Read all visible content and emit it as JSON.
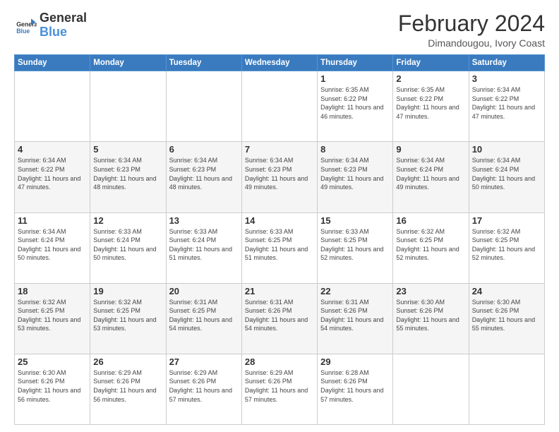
{
  "logo": {
    "line1": "General",
    "line2": "Blue"
  },
  "title": "February 2024",
  "subtitle": "Dimandougou, Ivory Coast",
  "days_of_week": [
    "Sunday",
    "Monday",
    "Tuesday",
    "Wednesday",
    "Thursday",
    "Friday",
    "Saturday"
  ],
  "weeks": [
    [
      {
        "day": "",
        "info": ""
      },
      {
        "day": "",
        "info": ""
      },
      {
        "day": "",
        "info": ""
      },
      {
        "day": "",
        "info": ""
      },
      {
        "day": "1",
        "info": "Sunrise: 6:35 AM\nSunset: 6:22 PM\nDaylight: 11 hours and 46 minutes."
      },
      {
        "day": "2",
        "info": "Sunrise: 6:35 AM\nSunset: 6:22 PM\nDaylight: 11 hours and 47 minutes."
      },
      {
        "day": "3",
        "info": "Sunrise: 6:34 AM\nSunset: 6:22 PM\nDaylight: 11 hours and 47 minutes."
      }
    ],
    [
      {
        "day": "4",
        "info": "Sunrise: 6:34 AM\nSunset: 6:22 PM\nDaylight: 11 hours and 47 minutes."
      },
      {
        "day": "5",
        "info": "Sunrise: 6:34 AM\nSunset: 6:23 PM\nDaylight: 11 hours and 48 minutes."
      },
      {
        "day": "6",
        "info": "Sunrise: 6:34 AM\nSunset: 6:23 PM\nDaylight: 11 hours and 48 minutes."
      },
      {
        "day": "7",
        "info": "Sunrise: 6:34 AM\nSunset: 6:23 PM\nDaylight: 11 hours and 49 minutes."
      },
      {
        "day": "8",
        "info": "Sunrise: 6:34 AM\nSunset: 6:23 PM\nDaylight: 11 hours and 49 minutes."
      },
      {
        "day": "9",
        "info": "Sunrise: 6:34 AM\nSunset: 6:24 PM\nDaylight: 11 hours and 49 minutes."
      },
      {
        "day": "10",
        "info": "Sunrise: 6:34 AM\nSunset: 6:24 PM\nDaylight: 11 hours and 50 minutes."
      }
    ],
    [
      {
        "day": "11",
        "info": "Sunrise: 6:34 AM\nSunset: 6:24 PM\nDaylight: 11 hours and 50 minutes."
      },
      {
        "day": "12",
        "info": "Sunrise: 6:33 AM\nSunset: 6:24 PM\nDaylight: 11 hours and 50 minutes."
      },
      {
        "day": "13",
        "info": "Sunrise: 6:33 AM\nSunset: 6:24 PM\nDaylight: 11 hours and 51 minutes."
      },
      {
        "day": "14",
        "info": "Sunrise: 6:33 AM\nSunset: 6:25 PM\nDaylight: 11 hours and 51 minutes."
      },
      {
        "day": "15",
        "info": "Sunrise: 6:33 AM\nSunset: 6:25 PM\nDaylight: 11 hours and 52 minutes."
      },
      {
        "day": "16",
        "info": "Sunrise: 6:32 AM\nSunset: 6:25 PM\nDaylight: 11 hours and 52 minutes."
      },
      {
        "day": "17",
        "info": "Sunrise: 6:32 AM\nSunset: 6:25 PM\nDaylight: 11 hours and 52 minutes."
      }
    ],
    [
      {
        "day": "18",
        "info": "Sunrise: 6:32 AM\nSunset: 6:25 PM\nDaylight: 11 hours and 53 minutes."
      },
      {
        "day": "19",
        "info": "Sunrise: 6:32 AM\nSunset: 6:25 PM\nDaylight: 11 hours and 53 minutes."
      },
      {
        "day": "20",
        "info": "Sunrise: 6:31 AM\nSunset: 6:25 PM\nDaylight: 11 hours and 54 minutes."
      },
      {
        "day": "21",
        "info": "Sunrise: 6:31 AM\nSunset: 6:26 PM\nDaylight: 11 hours and 54 minutes."
      },
      {
        "day": "22",
        "info": "Sunrise: 6:31 AM\nSunset: 6:26 PM\nDaylight: 11 hours and 54 minutes."
      },
      {
        "day": "23",
        "info": "Sunrise: 6:30 AM\nSunset: 6:26 PM\nDaylight: 11 hours and 55 minutes."
      },
      {
        "day": "24",
        "info": "Sunrise: 6:30 AM\nSunset: 6:26 PM\nDaylight: 11 hours and 55 minutes."
      }
    ],
    [
      {
        "day": "25",
        "info": "Sunrise: 6:30 AM\nSunset: 6:26 PM\nDaylight: 11 hours and 56 minutes."
      },
      {
        "day": "26",
        "info": "Sunrise: 6:29 AM\nSunset: 6:26 PM\nDaylight: 11 hours and 56 minutes."
      },
      {
        "day": "27",
        "info": "Sunrise: 6:29 AM\nSunset: 6:26 PM\nDaylight: 11 hours and 57 minutes."
      },
      {
        "day": "28",
        "info": "Sunrise: 6:29 AM\nSunset: 6:26 PM\nDaylight: 11 hours and 57 minutes."
      },
      {
        "day": "29",
        "info": "Sunrise: 6:28 AM\nSunset: 6:26 PM\nDaylight: 11 hours and 57 minutes."
      },
      {
        "day": "",
        "info": ""
      },
      {
        "day": "",
        "info": ""
      }
    ]
  ]
}
